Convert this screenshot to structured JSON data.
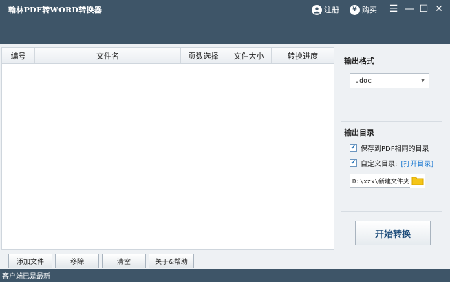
{
  "app": {
    "title": "翰林PDF转WORD转换器"
  },
  "header": {
    "register_label": "注册",
    "register_icon": "user-icon",
    "buy_label": "购买",
    "buy_icon": "yen-icon",
    "buy_icon_glyph": "¥"
  },
  "window_controls": {
    "menu": "☰",
    "minimize": "—",
    "maximize": "☐",
    "close": "✕"
  },
  "file_table": {
    "columns": [
      "编号",
      "文件名",
      "页数选择",
      "文件大小",
      "转换进度"
    ],
    "rows": []
  },
  "output_format": {
    "label": "输出格式",
    "value": ".doc"
  },
  "output_dir": {
    "label": "输出目录",
    "option_same": "保存到PDF相同的目录",
    "option_custom": "自定义目录:",
    "open_dir_link": "[打开目录]",
    "path": "D:\\xzx\\新建文件夹",
    "option_same_checked": true,
    "option_custom_checked": true,
    "check_glyph": "✔"
  },
  "actions": {
    "start": "开始转换"
  },
  "bottom_buttons": {
    "add": "添加文件",
    "remove": "移除",
    "clear": "清空",
    "about": "关于&帮助"
  },
  "status": {
    "text": "客户端已是最新"
  },
  "colors": {
    "titlebar": "#3e5568",
    "link": "#1a78d0",
    "folder": "#f5c518"
  }
}
